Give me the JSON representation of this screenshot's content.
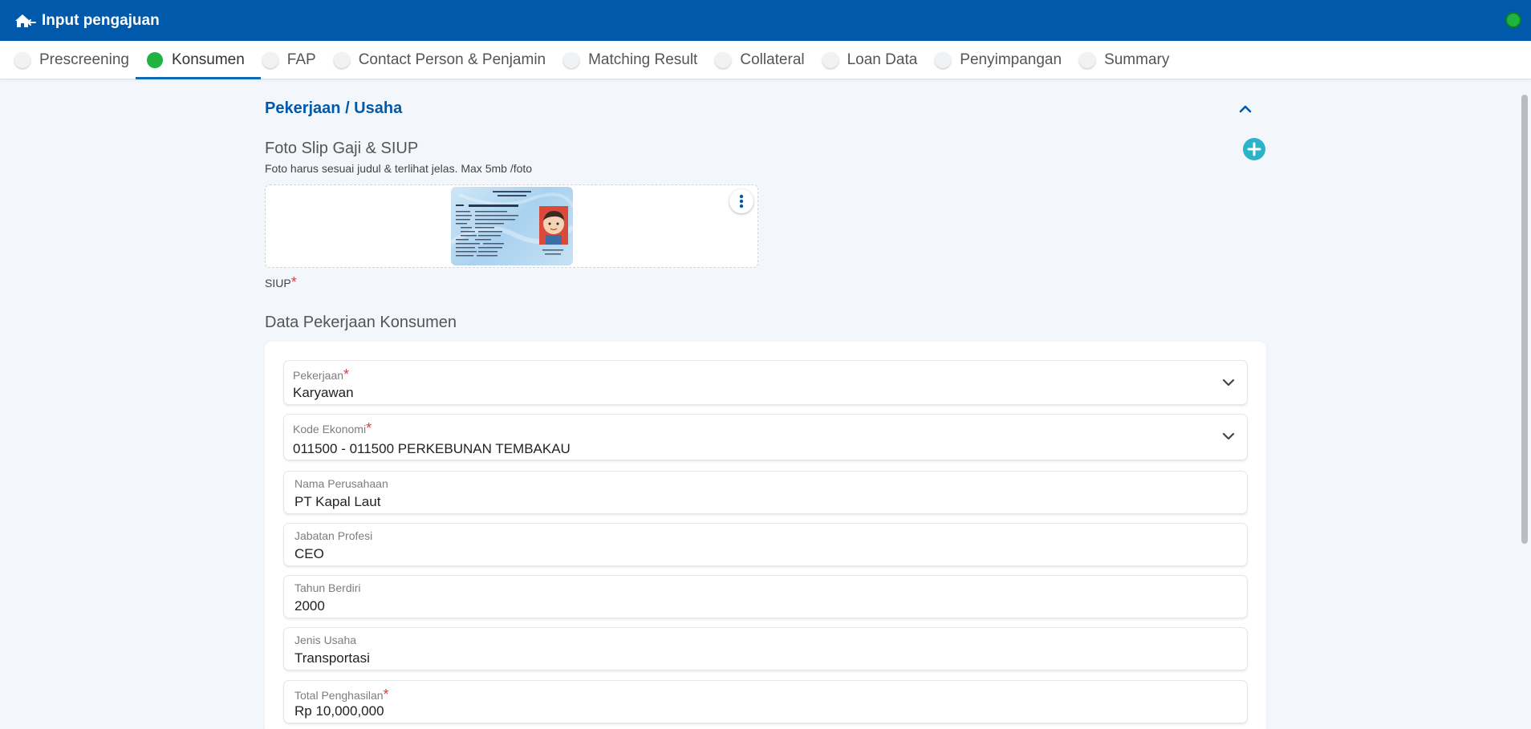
{
  "header": {
    "title": "Input pengajuan",
    "status_color": "#1fb341",
    "back_icon": "home-back-icon"
  },
  "steps": [
    {
      "label": "Prescreening",
      "active": false
    },
    {
      "label": "Konsumen",
      "active": true
    },
    {
      "label": "FAP",
      "active": false
    },
    {
      "label": "Contact Person & Penjamin",
      "active": false
    },
    {
      "label": "Matching Result",
      "active": false
    },
    {
      "label": "Collateral",
      "active": false
    },
    {
      "label": "Loan Data",
      "active": false
    },
    {
      "label": "Penyimpangan",
      "active": false
    },
    {
      "label": "Summary",
      "active": false
    }
  ],
  "section": {
    "title": "Pekerjaan / Usaha"
  },
  "photo": {
    "title": "Foto Slip Gaji & SIUP",
    "hint": "Foto harus sesuai judul & terlihat jelas. Max 5mb /foto",
    "caption": "SIUP",
    "required_mark": "*"
  },
  "form": {
    "title": "Data Pekerjaan Konsumen",
    "fields": [
      {
        "label": "Pekerjaan",
        "value": "Karyawan",
        "required": "*",
        "type": "select"
      },
      {
        "label": "Kode Ekonomi",
        "value": "011500 - 011500 PERKEBUNAN TEMBAKAU",
        "required": "*",
        "type": "select"
      },
      {
        "label": "Nama Perusahaan",
        "value": "PT Kapal Laut",
        "required": "",
        "type": "text"
      },
      {
        "label": "Jabatan Profesi",
        "value": "CEO",
        "required": "",
        "type": "text"
      },
      {
        "label": "Tahun Berdiri",
        "value": "2000",
        "required": "",
        "type": "text"
      },
      {
        "label": "Jenis Usaha",
        "value": "Transportasi",
        "required": "",
        "type": "text"
      },
      {
        "label": "Total Penghasilan",
        "value": "Rp 10,000,000",
        "required": "*",
        "type": "text"
      }
    ]
  },
  "colors": {
    "brand": "#0159ab",
    "active_step": "#1fb341",
    "add_button": "#2bb3c8",
    "required": "#e53935"
  }
}
